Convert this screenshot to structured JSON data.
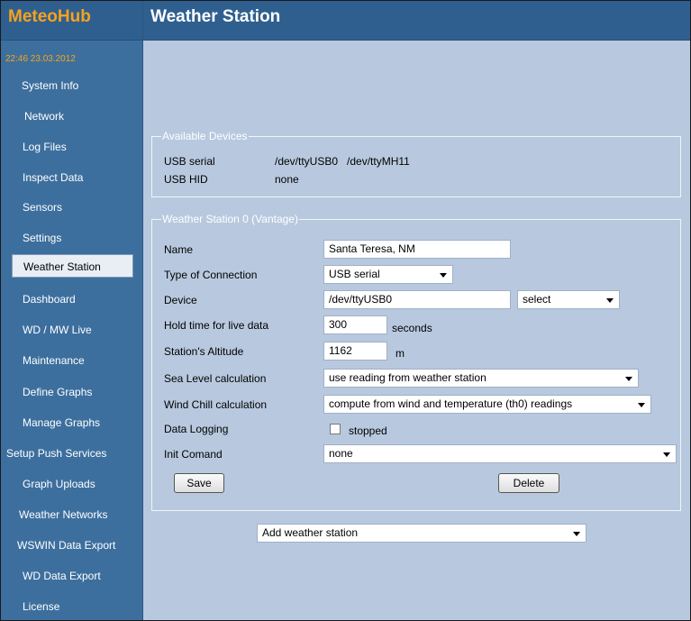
{
  "app": {
    "brand": "MeteoHub",
    "clock": "22:46  23.03.2012"
  },
  "page": {
    "title": "Weather Station"
  },
  "sidebar": {
    "items": [
      {
        "label": "System Info"
      },
      {
        "label": "Network"
      },
      {
        "label": "Log Files"
      },
      {
        "label": "Inspect Data"
      },
      {
        "label": "Sensors"
      },
      {
        "label": "Settings"
      },
      {
        "label": "Weather Station",
        "active": true
      },
      {
        "label": "Dashboard"
      },
      {
        "label": "WD / MW Live"
      },
      {
        "label": "Maintenance"
      },
      {
        "label": "Define Graphs"
      },
      {
        "label": "Manage Graphs"
      },
      {
        "label": "Setup Push Services"
      },
      {
        "label": "Graph Uploads"
      },
      {
        "label": "Weather Networks"
      },
      {
        "label": "WSWIN Data Export"
      },
      {
        "label": "WD Data Export"
      },
      {
        "label": "License"
      }
    ]
  },
  "devices": {
    "legend": "Available Devices",
    "usb_serial_label": "USB serial",
    "usb_serial_value": "/dev/ttyUSB0   /dev/ttyMH11",
    "usb_hid_label": "USB HID",
    "usb_hid_value": "none"
  },
  "station": {
    "legend": "Weather Station 0 (Vantage)",
    "name_label": "Name",
    "name_value": "Santa Teresa, NM",
    "connection_label": "Type of Connection",
    "connection_value": "USB serial",
    "device_label": "Device",
    "device_value": "/dev/ttyUSB0",
    "device_select": "select",
    "hold_label": "Hold time for live data",
    "hold_value": "300",
    "hold_unit": "seconds",
    "altitude_label": "Station's Altitude",
    "altitude_value": "1162",
    "altitude_unit": "m",
    "sealevel_label": "Sea Level calculation",
    "sealevel_value": "use reading from weather station",
    "windchill_label": "Wind Chill calculation",
    "windchill_value": "compute from wind and temperature (th0) readings",
    "logging_label": "Data Logging",
    "logging_value": "stopped",
    "init_label": "Init Comand",
    "init_value": "none",
    "save_label": "Save",
    "delete_label": "Delete"
  },
  "add_station": {
    "value": "Add weather station"
  },
  "colors": {
    "brand_text": "#f6a21b",
    "header_bg": "#2f5f8f",
    "sidebar_bg": "#3d6f9e",
    "content_bg": "#b8c9df"
  }
}
